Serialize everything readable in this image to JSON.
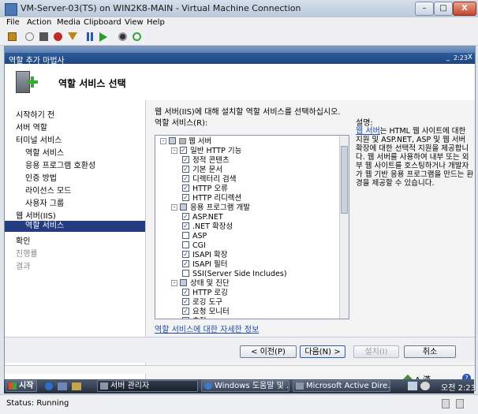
{
  "window": {
    "title": "VM-Server-03(TS) on WIN2K8-MAIN - Virtual Machine Connection",
    "minimize": "–",
    "maximize": "□",
    "close": "X"
  },
  "menubar": [
    "File",
    "Action",
    "Media",
    "Clipboard",
    "View",
    "Help"
  ],
  "guest_window_title": "서버 관리자",
  "dialog": {
    "title": "역할 추가 마법사",
    "controls": [
      "_",
      "2:23",
      "X"
    ],
    "header": "역할 서비스 선택"
  },
  "nav": [
    {
      "label": "시작하기 전",
      "state": "normal"
    },
    {
      "label": "서버 역할",
      "state": "normal"
    },
    {
      "label": "터미널 서비스",
      "state": "normal"
    },
    {
      "label": "역할 서비스",
      "state": "normal"
    },
    {
      "label": "응용 프로그램 호환성",
      "state": "normal"
    },
    {
      "label": "인증 방법",
      "state": "normal"
    },
    {
      "label": "라이선스 모드",
      "state": "normal"
    },
    {
      "label": "사용자 그룹",
      "state": "normal"
    },
    {
      "label": "웹 서버(IIS)",
      "state": "normal"
    },
    {
      "label": "역할 서비스",
      "state": "selected"
    },
    {
      "label": "확인",
      "state": "normal"
    },
    {
      "label": "진행률",
      "state": "disabled"
    },
    {
      "label": "결과",
      "state": "disabled"
    }
  ],
  "main": {
    "instruction": "웹 서버(IIS)에 대해 설치할 역할 서비스를 선택하십시오.",
    "list_label": "역할 서비스(R):",
    "desc_label": "설명:",
    "desc_link": "웹 서버",
    "desc_text": "는 HTML 웹 사이트에 대한 지원 및 ASP.NET, ASP 및 웹 서버 확장에 대한 선택적 지원을 제공합니다. 웹 서버를 사용하여 내부 또는 외부 웹 사이트를 호스팅하거나 개발자가 웹 기반 응용 프로그램을 만드는 환경을 제공할 수 있습니다.",
    "more_info_link": "역할 서비스에 대한 자세한 정보"
  },
  "tree": [
    {
      "label": "웹 서버",
      "level": 0,
      "check": "partial",
      "expand": "-"
    },
    {
      "label": "일반 HTTP 기능",
      "level": 1,
      "check": "checked",
      "expand": "-"
    },
    {
      "label": "정적 콘텐츠",
      "level": 2,
      "check": "checked"
    },
    {
      "label": "기본 문서",
      "level": 2,
      "check": "checked"
    },
    {
      "label": "디렉터리 검색",
      "level": 2,
      "check": "checked"
    },
    {
      "label": "HTTP 오류",
      "level": 2,
      "check": "checked"
    },
    {
      "label": "HTTP 리디렉션",
      "level": 2,
      "check": "checked"
    },
    {
      "label": "응용 프로그램 개발",
      "level": 1,
      "check": "partial",
      "expand": "-"
    },
    {
      "label": "ASP.NET",
      "level": 2,
      "check": "checked"
    },
    {
      "label": ".NET 확장성",
      "level": 2,
      "check": "checked"
    },
    {
      "label": "ASP",
      "level": 2,
      "check": "unchecked"
    },
    {
      "label": "CGI",
      "level": 2,
      "check": "unchecked"
    },
    {
      "label": "ISAPI 확장",
      "level": 2,
      "check": "checked"
    },
    {
      "label": "ISAPI 필터",
      "level": 2,
      "check": "checked"
    },
    {
      "label": "SSI(Server Side Includes)",
      "level": 2,
      "check": "unchecked"
    },
    {
      "label": "상태 및 진단",
      "level": 1,
      "check": "partial",
      "expand": "-"
    },
    {
      "label": "HTTP 로깅",
      "level": 2,
      "check": "checked"
    },
    {
      "label": "로깅 도구",
      "level": 2,
      "check": "checked"
    },
    {
      "label": "요청 모니터",
      "level": 2,
      "check": "checked"
    },
    {
      "label": "추적",
      "level": 2,
      "check": "checked"
    }
  ],
  "buttons": {
    "prev": "< 이전(P)",
    "next": "다음(N) >",
    "install": "설치(I)",
    "cancel": "취소"
  },
  "ime": "A 漢",
  "taskbar": {
    "start": "시작",
    "tasks": [
      {
        "label": "서버 관리자",
        "active": true
      },
      {
        "label": "Windows 도움말 및 ...",
        "active": false
      },
      {
        "label": "Microsoft Active Dire...",
        "active": false
      }
    ],
    "clock": "오전 2:23"
  },
  "status": {
    "text": "Status: Running"
  },
  "colors": {
    "accent": "#243b80",
    "link": "#1f4ea8",
    "dialog_title": "#1d467f"
  }
}
